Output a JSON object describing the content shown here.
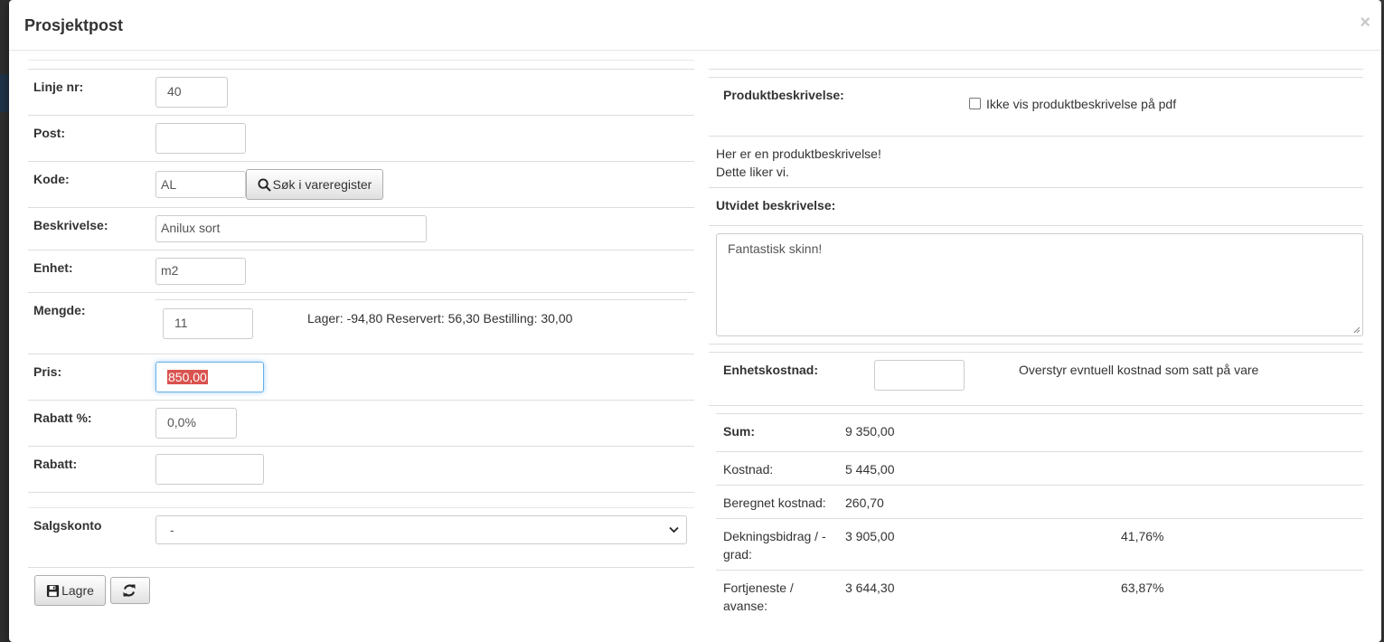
{
  "modal": {
    "title": "Prosjektpost",
    "close_label": "×"
  },
  "left": {
    "line_no": {
      "label": "Linje nr:",
      "value": "40"
    },
    "post": {
      "label": "Post:",
      "value": ""
    },
    "code": {
      "label": "Kode:",
      "value": "AL",
      "search_button": "Søk i vareregister"
    },
    "description": {
      "label": "Beskrivelse:",
      "value": "Anilux sort"
    },
    "unit": {
      "label": "Enhet:",
      "value": "m2"
    },
    "quantity": {
      "label": "Mengde:",
      "value": "11",
      "stock_info": "Lager: -94,80 Reservert: 56,30 Bestilling: 30,00"
    },
    "price": {
      "label": "Pris:",
      "value": "850,00"
    },
    "discount_pct": {
      "label": "Rabatt %:",
      "value": "0,0%"
    },
    "discount": {
      "label": "Rabatt:",
      "value": ""
    },
    "sales_account": {
      "label": "Salgskonto",
      "selected": "-"
    },
    "save_button": "Lagre"
  },
  "right": {
    "product_description": {
      "label": "Produktbeskrivelse:",
      "hide_checkbox_label": "Ikke vis produktbeskrivelse på pdf",
      "hide_checked": false,
      "text_line1": "Her er en produktbeskrivelse!",
      "text_line2": "Dette liker vi."
    },
    "extended_description": {
      "label": "Utvidet beskrivelse:",
      "value": "Fantastisk skinn!"
    },
    "unit_cost": {
      "label": "Enhetskostnad:",
      "value": "",
      "hint": "Overstyr evntuell kostnad som satt på vare"
    },
    "summary": {
      "sum": {
        "label": "Sum:",
        "value": "9 350,00"
      },
      "cost": {
        "label": "Kostnad:",
        "value": "5 445,00"
      },
      "calculated_cost": {
        "label": "Beregnet kostnad:",
        "value": "260,70"
      },
      "contribution": {
        "label_line1": "Dekningsbidrag / -",
        "label_line2": "grad:",
        "value": "3 905,00",
        "percent": "41,76%"
      },
      "profit": {
        "label_line1": "Fortjeneste /",
        "label_line2": "avanse:",
        "value": "3 644,30",
        "percent": "63,87%"
      }
    }
  },
  "colors": {
    "focus_border": "#66afe9",
    "selection": "#d9534f"
  }
}
